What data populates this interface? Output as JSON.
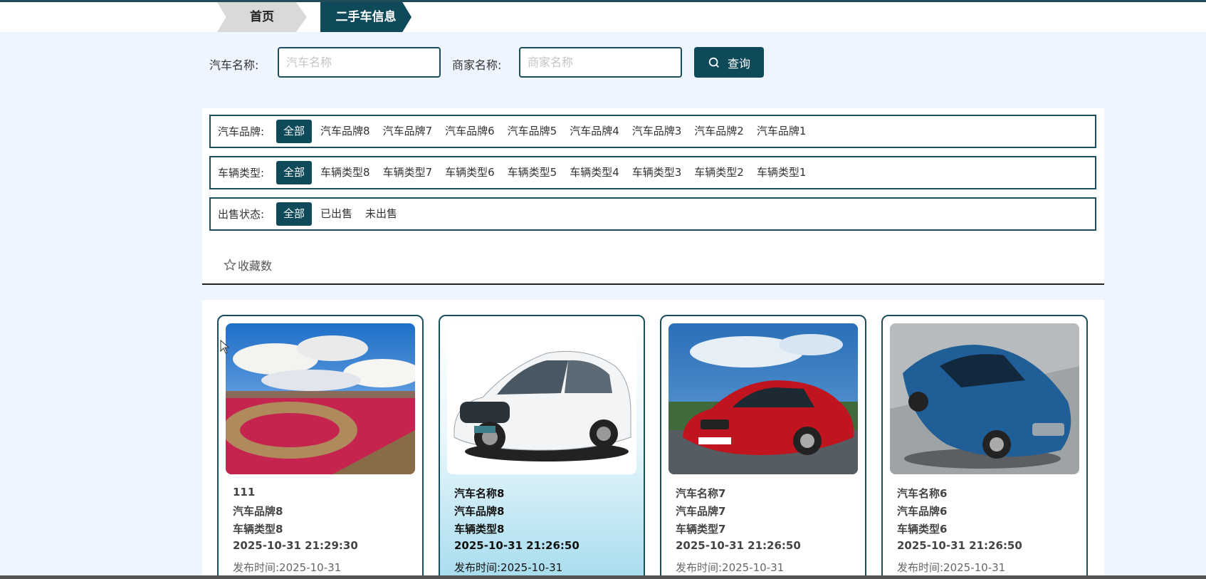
{
  "breadcrumb": {
    "home": "首页",
    "current": "二手车信息"
  },
  "search": {
    "car_name_label": "汽车名称:",
    "car_name_placeholder": "汽车名称",
    "merchant_label": "商家名称:",
    "merchant_placeholder": "商家名称",
    "query_label": "查询"
  },
  "filters": {
    "brand": {
      "label": "汽车品牌:",
      "options": [
        "全部",
        "汽车品牌8",
        "汽车品牌7",
        "汽车品牌6",
        "汽车品牌5",
        "汽车品牌4",
        "汽车品牌3",
        "汽车品牌2",
        "汽车品牌1"
      ]
    },
    "type": {
      "label": "车辆类型:",
      "options": [
        "全部",
        "车辆类型8",
        "车辆类型7",
        "车辆类型6",
        "车辆类型5",
        "车辆类型4",
        "车辆类型3",
        "车辆类型2",
        "车辆类型1"
      ]
    },
    "status": {
      "label": "出售状态:",
      "options": [
        "全部",
        "已出售",
        "未出售"
      ]
    }
  },
  "sort": {
    "favorites_label": "收藏数"
  },
  "cards": [
    {
      "name": "111",
      "brand": "汽车品牌8",
      "type": "车辆类型8",
      "datetime": "2025-10-31 21:29:30",
      "publish": "发布时间:2025-10-31"
    },
    {
      "name": "汽车名称8",
      "brand": "汽车品牌8",
      "type": "车辆类型8",
      "datetime": "2025-10-31 21:26:50",
      "publish": "发布时间:2025-10-31"
    },
    {
      "name": "汽车名称7",
      "brand": "汽车品牌7",
      "type": "车辆类型7",
      "datetime": "2025-10-31 21:26:50",
      "publish": "发布时间:2025-10-31"
    },
    {
      "name": "汽车名称6",
      "brand": "汽车品牌6",
      "type": "车辆类型6",
      "datetime": "2025-10-31 21:26:50",
      "publish": "发布时间:2025-10-31"
    }
  ],
  "colors": {
    "accent": "#0e4a5a",
    "page_bg": "#eef5fe"
  }
}
